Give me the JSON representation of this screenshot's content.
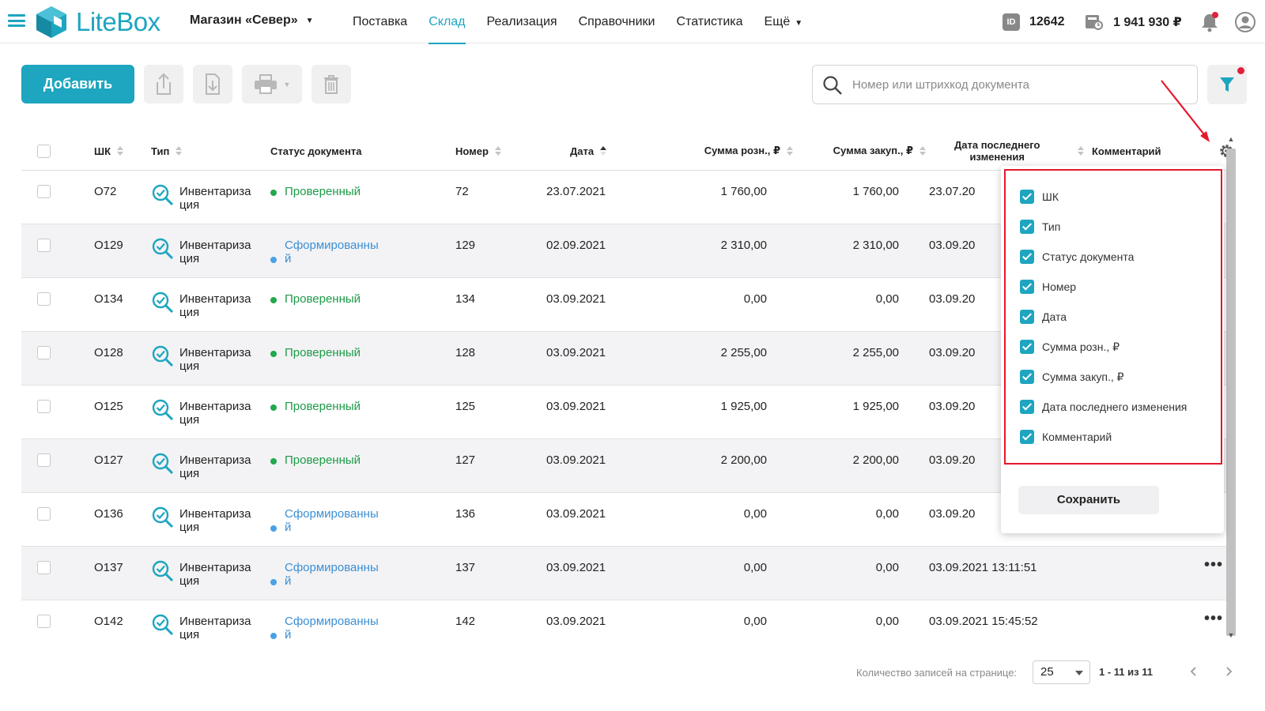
{
  "app": {
    "logo_text": "LiteBox",
    "store_name": "Магазин «Север»",
    "nav": [
      "Поставка",
      "Склад",
      "Реализация",
      "Справочники",
      "Статистика",
      "Ещё"
    ],
    "id_badge": "ID",
    "account_id": "12642",
    "balance": "1 941 930 ₽"
  },
  "toolbar": {
    "add_label": "Добавить",
    "search_placeholder": "Номер или штрихкод документа"
  },
  "table": {
    "headers": {
      "barcode": "ШК",
      "type": "Тип",
      "status": "Статус документа",
      "number": "Номер",
      "date": "Дата",
      "retail_sum": "Сумма розн., ₽",
      "purchase_sum": "Сумма закуп., ₽",
      "last_change_1": "Дата последнего",
      "last_change_2": "изменения",
      "comment": "Комментарий"
    },
    "rows": [
      {
        "barcode": "О72",
        "type_1": "Инвентариза",
        "type_2": "ция",
        "status_1": "Проверенный",
        "status_2": "",
        "status_kind": "ok",
        "number": "72",
        "date": "23.07.2021",
        "retail": "1 760,00",
        "purchase": "1 760,00",
        "changed": "23.07.20",
        "more": false
      },
      {
        "barcode": "О129",
        "type_1": "Инвентариза",
        "type_2": "ция",
        "status_1": "Сформированны",
        "status_2": "й",
        "status_kind": "formed",
        "number": "129",
        "date": "02.09.2021",
        "retail": "2 310,00",
        "purchase": "2 310,00",
        "changed": "03.09.20",
        "more": false
      },
      {
        "barcode": "О134",
        "type_1": "Инвентариза",
        "type_2": "ция",
        "status_1": "Проверенный",
        "status_2": "",
        "status_kind": "ok",
        "number": "134",
        "date": "03.09.2021",
        "retail": "0,00",
        "purchase": "0,00",
        "changed": "03.09.20",
        "more": false
      },
      {
        "barcode": "О128",
        "type_1": "Инвентариза",
        "type_2": "ция",
        "status_1": "Проверенный",
        "status_2": "",
        "status_kind": "ok",
        "number": "128",
        "date": "03.09.2021",
        "retail": "2 255,00",
        "purchase": "2 255,00",
        "changed": "03.09.20",
        "more": false
      },
      {
        "barcode": "О125",
        "type_1": "Инвентариза",
        "type_2": "ция",
        "status_1": "Проверенный",
        "status_2": "",
        "status_kind": "ok",
        "number": "125",
        "date": "03.09.2021",
        "retail": "1 925,00",
        "purchase": "1 925,00",
        "changed": "03.09.20",
        "more": false
      },
      {
        "barcode": "О127",
        "type_1": "Инвентариза",
        "type_2": "ция",
        "status_1": "Проверенный",
        "status_2": "",
        "status_kind": "ok",
        "number": "127",
        "date": "03.09.2021",
        "retail": "2 200,00",
        "purchase": "2 200,00",
        "changed": "03.09.20",
        "more": false
      },
      {
        "barcode": "О136",
        "type_1": "Инвентариза",
        "type_2": "ция",
        "status_1": "Сформированны",
        "status_2": "й",
        "status_kind": "formed",
        "number": "136",
        "date": "03.09.2021",
        "retail": "0,00",
        "purchase": "0,00",
        "changed": "03.09.20",
        "more": false
      },
      {
        "barcode": "О137",
        "type_1": "Инвентариза",
        "type_2": "ция",
        "status_1": "Сформированны",
        "status_2": "й",
        "status_kind": "formed",
        "number": "137",
        "date": "03.09.2021",
        "retail": "0,00",
        "purchase": "0,00",
        "changed": "03.09.2021 13:11:51",
        "more": true
      },
      {
        "barcode": "О142",
        "type_1": "Инвентариза",
        "type_2": "ция",
        "status_1": "Сформированны",
        "status_2": "й",
        "status_kind": "formed",
        "number": "142",
        "date": "03.09.2021",
        "retail": "0,00",
        "purchase": "0,00",
        "changed": "03.09.2021 15:45:52",
        "more": true
      }
    ]
  },
  "columns_popup": {
    "items": [
      "ШК",
      "Тип",
      "Статус документа",
      "Номер",
      "Дата",
      "Сумма розн., ₽",
      "Сумма закуп., ₽",
      "Дата последнего изменения",
      "Комментарий"
    ],
    "save_label": "Сохранить"
  },
  "pagination": {
    "per_page_label": "Количество записей на странице:",
    "per_page_value": "25",
    "range_text": "1 - 11 из 11"
  },
  "colors": {
    "accent": "#1ea5c0",
    "status_ok": "#1d9b48",
    "status_formed": "#3b8fd4",
    "highlight": "#e5182b"
  }
}
